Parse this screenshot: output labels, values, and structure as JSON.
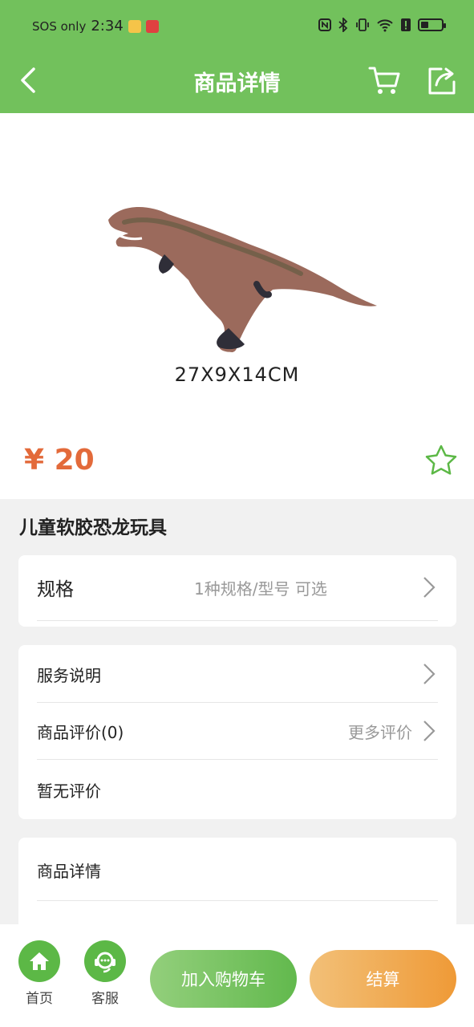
{
  "status_bar": {
    "carrier": "SOS only",
    "time": "2:34"
  },
  "header": {
    "title": "商品详情",
    "back_icon": "chevron-left-icon",
    "cart_icon": "cart-icon",
    "share_icon": "share-icon"
  },
  "product": {
    "image_caption": "27X9X14CM",
    "price": "¥ 20",
    "name": "儿童软胶恐龙玩具"
  },
  "spec": {
    "label": "规格",
    "value": "1种规格/型号 可选"
  },
  "service": {
    "label": "服务说明"
  },
  "reviews": {
    "label": "商品评价(0)",
    "more": "更多评价",
    "empty": "暂无评价"
  },
  "details": {
    "label": "商品详情"
  },
  "bottom_bar": {
    "home_label": "首页",
    "service_label": "客服",
    "add_to_cart": "加入购物车",
    "checkout": "结算"
  },
  "colors": {
    "brand_green": "#72c15c",
    "price_orange": "#e36a3a",
    "checkout_orange": "#ef9a37"
  }
}
